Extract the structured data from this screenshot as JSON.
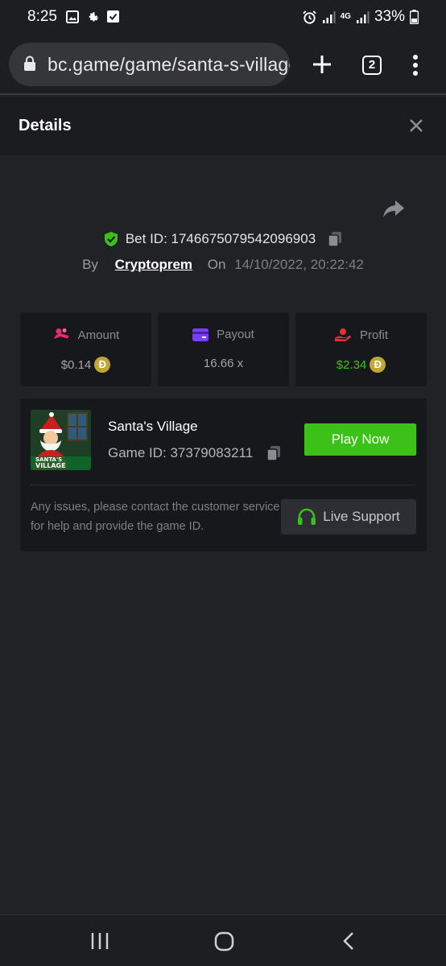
{
  "status_bar": {
    "time": "8:25",
    "battery": "33%",
    "network": "4G"
  },
  "browser": {
    "url": "bc.game/game/santa-s-village",
    "tab_count": "2"
  },
  "details": {
    "title": "Details"
  },
  "bet": {
    "id_label": "Bet ID: 1746675079542096903",
    "by_label": "By",
    "user": "Cryptoprem",
    "on_label": "On",
    "date": "14/10/2022, 20:22:42"
  },
  "stats": {
    "amount": {
      "label": "Amount",
      "value": "$0.14",
      "color": "#ee2b6c"
    },
    "payout": {
      "label": "Payout",
      "value": "16.66 x",
      "color": "#7b3ff2"
    },
    "profit": {
      "label": "Profit",
      "value": "$2.34",
      "color": "#e03232",
      "value_color": "#3bc117"
    },
    "coin_symbol": "Ð",
    "coin_color": "#c2a633"
  },
  "game": {
    "title": "Santa's Village",
    "id_label": "Game ID: 37379083211",
    "play_label": "Play Now",
    "thumb_text_1": "SANTA'S",
    "thumb_text_2": "VILLAGE",
    "issue_text": "Any issues, please contact the customer service for help and provide the game ID.",
    "support_label": "Live Support",
    "accent": "#3bc117"
  },
  "icons": [
    "image-icon",
    "gear-icon",
    "checkbox-icon",
    "alarm-icon",
    "signal-icon",
    "battery-icon",
    "lock-icon",
    "plus-icon",
    "more-icon",
    "close-icon",
    "share-icon",
    "shield-check-icon",
    "copy-icon",
    "headset-icon",
    "recents-icon",
    "home-icon",
    "back-icon"
  ]
}
